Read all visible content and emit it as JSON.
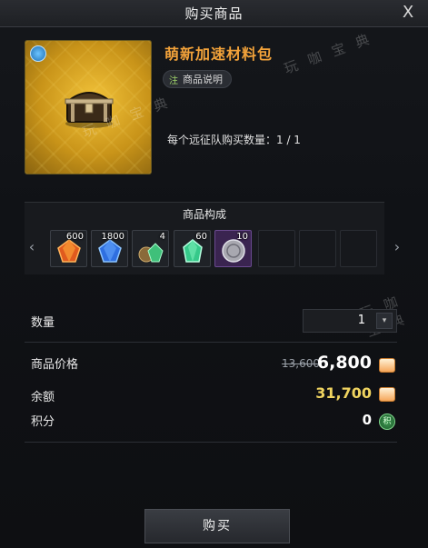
{
  "dialog": {
    "title": "购买商品",
    "close_label": "X"
  },
  "product": {
    "name": "萌新加速材料包",
    "description_label": "商品说明",
    "description_icon": "注",
    "purchase_limit": "每个远征队购买数量：1 / 1"
  },
  "contents": {
    "title": "商品构成",
    "prev_arrow": "‹",
    "next_arrow": "›",
    "items": [
      {
        "qty": "600",
        "icon": "red-crystal-icon",
        "color": "#e05a1e"
      },
      {
        "qty": "1800",
        "icon": "blue-crystal-icon",
        "color": "#2f6fe0"
      },
      {
        "qty": "4",
        "icon": "pouch-green-gem-icon",
        "color": "#3fc07a"
      },
      {
        "qty": "60",
        "icon": "green-crystal-icon",
        "color": "#36c98a"
      },
      {
        "qty": "10",
        "icon": "silver-coin-icon",
        "color": "#a8a8b0"
      }
    ]
  },
  "quantity": {
    "label": "数量",
    "value": "1",
    "stepper_glyph": "▾"
  },
  "price": {
    "label": "商品价格",
    "original": "13,600",
    "current": "6,800"
  },
  "balance": {
    "label": "余额",
    "value": "31,700"
  },
  "points": {
    "label": "积分",
    "value": "0",
    "icon_glyph": "积"
  },
  "buy_button": {
    "label": "购买"
  },
  "watermarks": [
    "玩 咖 宝 典",
    "玩 咖 宝 典",
    "玩 咖 宝 典"
  ],
  "colors": {
    "product_name": "#f2a23a",
    "balance": "#f0d460"
  }
}
